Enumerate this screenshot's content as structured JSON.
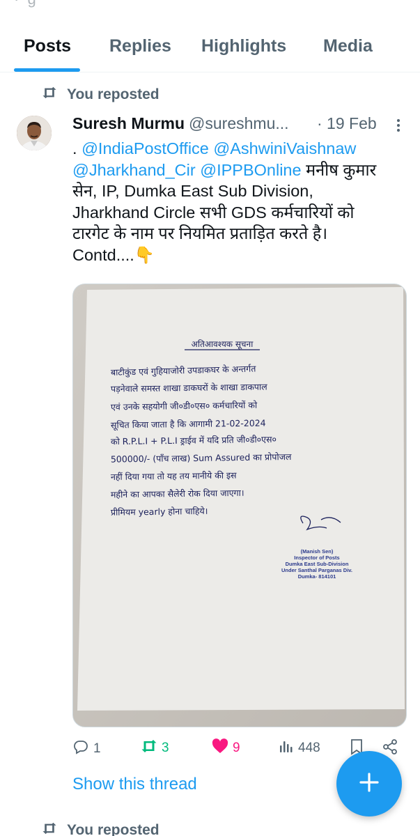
{
  "tabs": [
    {
      "label": "Posts",
      "active": true
    },
    {
      "label": "Replies",
      "active": false
    },
    {
      "label": "Highlights",
      "active": false
    },
    {
      "label": "Media",
      "active": false
    }
  ],
  "repost_label": "You reposted",
  "tweet": {
    "author_name": "Suresh Murmu",
    "author_handle": "@sureshmu...",
    "date": "· 19 Feb",
    "text_lines": [
      [
        {
          "t": ". ",
          "m": false
        },
        {
          "t": "@IndiaPostOffice",
          "m": true
        },
        {
          "t": " ",
          "m": false
        },
        {
          "t": "@AshwiniVaishnaw",
          "m": true
        }
      ],
      [
        {
          "t": "@Jharkhand_Cir",
          "m": true
        },
        {
          "t": " ",
          "m": false
        },
        {
          "t": "@IPPBOnline",
          "m": true
        },
        {
          "t": " मनीष कुमार",
          "m": false
        }
      ],
      [
        {
          "t": "सेन, IP, Dumka East Sub Division,",
          "m": false
        }
      ],
      [
        {
          "t": "Jharkhand Circle सभी GDS कर्मचारियों को",
          "m": false
        }
      ],
      [
        {
          "t": "टारगेट के नाम पर नियमित प्रताड़ित करते है।",
          "m": false
        }
      ],
      [
        {
          "t": "Contd....👇",
          "m": false
        }
      ]
    ],
    "media": {
      "letter_title": "अतिआवश्यक सूचना",
      "letter_lines": [
        "बाटीकुंड एवं गुहियाजोरी उपडाकघर के अन्तर्गत",
        "पड़नेवाले समस्त शाखा डाकघरों के शाखा डाकपाल",
        "एवं उनके सहयोगी जी०डी०एस० कर्मचारियों को",
        "सूचित किया जाता है कि आगामी 21-02-2024",
        "को R.P.L.I + P.L.I ड्राईव में यदि प्रति जी०डी०एस०",
        "500000/- (पाँच लाख) Sum Assured का प्रोपोजल",
        "नहीं दिया गया तो यह तय मानीये की इस",
        "महीने का आपका सैलेरी रोक दिया जाएगा।",
        "प्रीमियम yearly होना चाहिये।"
      ],
      "stamp_lines": [
        "(Manish Sen)",
        "Inspector of Posts",
        "Dumka East Sub-Division",
        "Under Santhal Parganas Div.",
        "Dumka- 814101"
      ]
    },
    "stats": {
      "replies": "1",
      "reposts": "3",
      "likes": "9",
      "views": "448"
    }
  },
  "show_thread_label": "Show this thread",
  "colors": {
    "accent": "#1d9bf0",
    "repost_green": "#00ba7c",
    "like_pink": "#f91880",
    "secondary_text": "#536471"
  }
}
